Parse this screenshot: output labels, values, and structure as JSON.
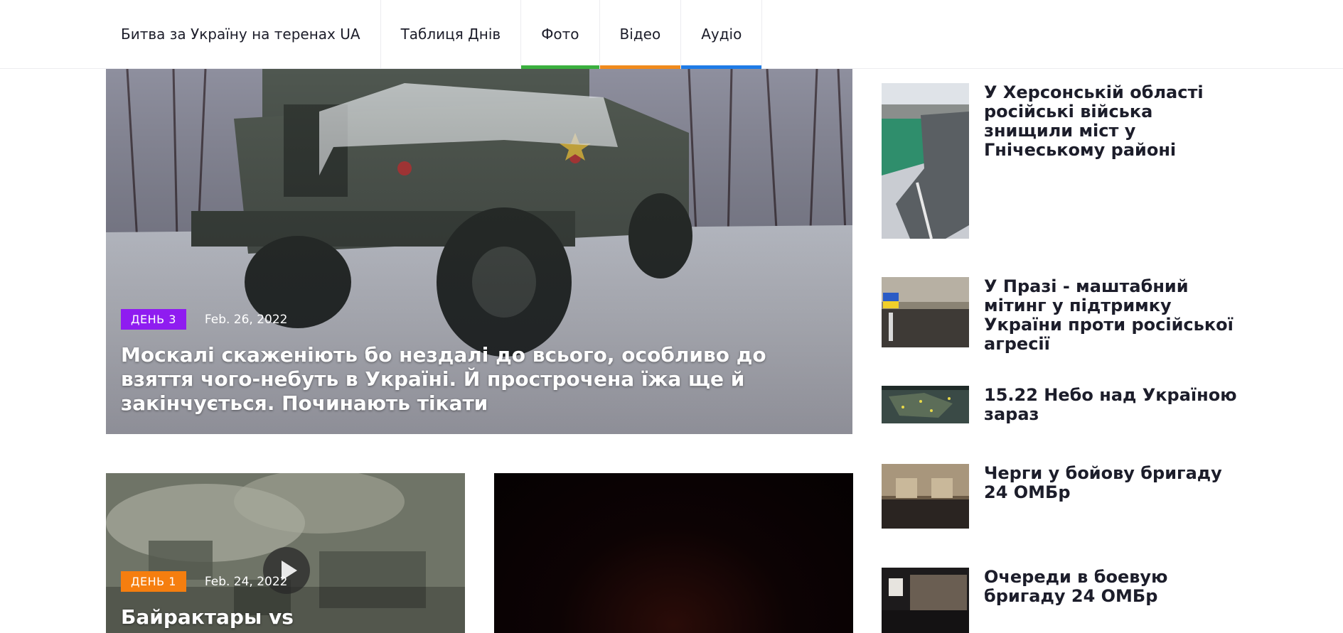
{
  "nav": {
    "items": [
      {
        "label": "Битва за Україну на теренах UA",
        "accent": ""
      },
      {
        "label": "Таблиця Днів",
        "accent": ""
      },
      {
        "label": "Фото",
        "accent": "#3ab03e"
      },
      {
        "label": "Відео",
        "accent": "#f08a1c"
      },
      {
        "label": "Аудіо",
        "accent": "#1f7be6"
      }
    ]
  },
  "featured": {
    "badge": "ДЕНЬ 3",
    "badge_color": "#8f1cf0",
    "date": "Feb. 26, 2022",
    "title": "Москалі скаженіють бо нездалі до всього, особливо до взяття чого-небуть в Україні. Й прострочена їжа ще й закінчується. Починають тікати"
  },
  "cards": [
    {
      "badge": "ДЕНЬ 1",
      "badge_color": "#f57e0f",
      "date": "Feb. 24, 2022",
      "title": "Байрактары vs",
      "has_play": true
    },
    {
      "badge": "",
      "badge_color": "",
      "date": "",
      "title": "",
      "has_play": false
    }
  ],
  "sidebar": {
    "items": [
      {
        "title": "У Херсонській області російські війська знищили міст у Гнічеському районі"
      },
      {
        "title": "У Празі - маштабний мітинг у підтримку України проти російської агресії"
      },
      {
        "title": "15.22 Небо над Україною зараз"
      },
      {
        "title": "Черги у бойову бригаду 24 ОМБр"
      },
      {
        "title": "Очереди в боевую бригаду 24 ОМБр"
      }
    ]
  }
}
